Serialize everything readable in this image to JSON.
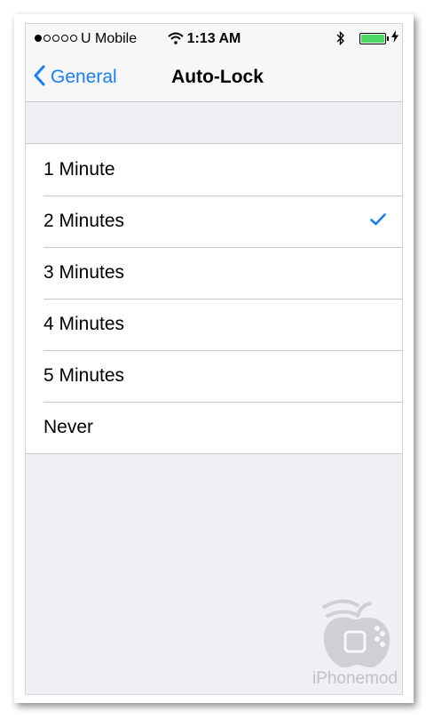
{
  "status_bar": {
    "signal": {
      "filled": 1,
      "total": 5
    },
    "carrier": "U Mobile",
    "time": "1:13 AM",
    "battery_level": 1.0,
    "battery_color": "#4cd964"
  },
  "nav": {
    "back_label": "General",
    "title": "Auto-Lock"
  },
  "options": [
    {
      "label": "1 Minute",
      "selected": false
    },
    {
      "label": "2 Minutes",
      "selected": true
    },
    {
      "label": "3 Minutes",
      "selected": false
    },
    {
      "label": "4 Minutes",
      "selected": false
    },
    {
      "label": "5 Minutes",
      "selected": false
    },
    {
      "label": "Never",
      "selected": false
    }
  ],
  "watermark": {
    "text": "iPhonemod"
  },
  "colors": {
    "accent": "#1a7ef5",
    "background": "#efeff4"
  }
}
